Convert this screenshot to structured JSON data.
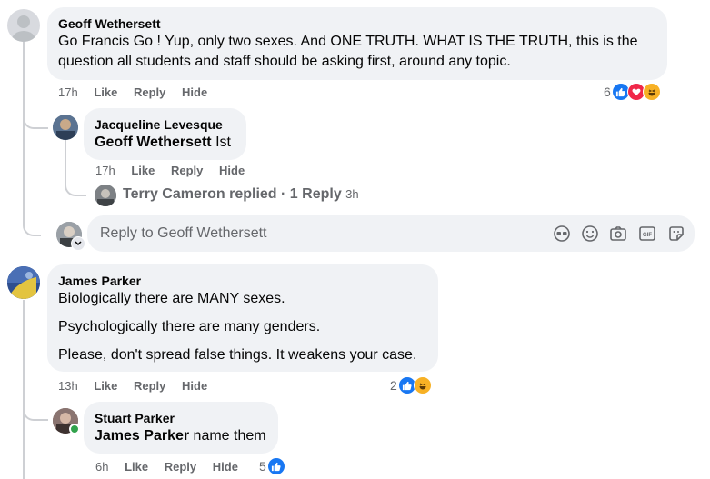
{
  "comments": [
    {
      "author": "Geoff Wethersett",
      "lines": [
        "Go Francis Go ! Yup, only two sexes. And ONE TRUTH. WHAT IS THE TRUTH, this is the",
        "question all students and staff should be asking first, around any topic."
      ],
      "time": "17h",
      "like": "Like",
      "reply": "Reply",
      "hide": "Hide",
      "reaction_count": "6"
    },
    {
      "author": "Jacqueline Levesque",
      "mention": "Geoff Wethersett",
      "text": "Ist",
      "time": "17h",
      "like": "Like",
      "reply": "Reply",
      "hide": "Hide"
    },
    {
      "author": "James Parker",
      "paragraphs": [
        "Biologically there are MANY sexes.",
        "Psychologically there are many genders.",
        "Please, don't spread false things. It weakens your case."
      ],
      "time": "13h",
      "like": "Like",
      "reply": "Reply",
      "hide": "Hide",
      "reaction_count": "2"
    },
    {
      "author": "Stuart Parker",
      "mention": "James Parker",
      "text": "name them",
      "time": "6h",
      "like": "Like",
      "reply": "Reply",
      "hide": "Hide",
      "reaction_count": "5"
    }
  ],
  "replies_summary": {
    "name": "Terry Cameron",
    "action": "replied",
    "separator": "·",
    "count": "1 Reply",
    "time": "3h"
  },
  "reply_input": {
    "placeholder": "Reply to Geoff Wethersett"
  },
  "colors": {
    "like": "#1877f2",
    "love": "#f02849",
    "haha": "#f7b125",
    "bubble": "#f0f2f5",
    "meta": "#65676b"
  }
}
